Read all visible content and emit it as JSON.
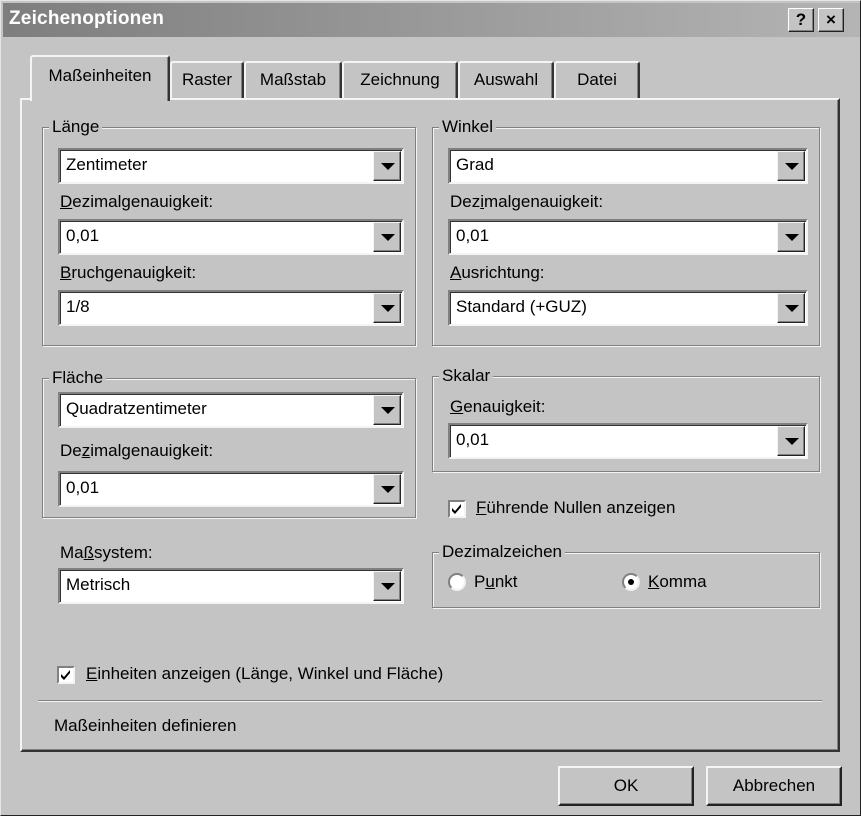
{
  "window": {
    "title": "Zeichenoptionen",
    "help_button": "?",
    "close_button": "×"
  },
  "tabs": [
    {
      "label": "Maßeinheiten",
      "active": true
    },
    {
      "label": "Raster"
    },
    {
      "label": "Maßstab"
    },
    {
      "label": "Zeichnung"
    },
    {
      "label": "Auswahl"
    },
    {
      "label": "Datei"
    }
  ],
  "laenge": {
    "group_label": "Länge",
    "unit_value": "Zentimeter",
    "decimal_label_u": "D",
    "decimal_label_rest": "ezimalgenauigkeit:",
    "decimal_value": "0,01",
    "fraction_label_u": "B",
    "fraction_label_rest": "ruchgenauigkeit:",
    "fraction_value": "1/8"
  },
  "winkel": {
    "group_label": "Winkel",
    "unit_value": "Grad",
    "decimal_label_pre": "Dez",
    "decimal_label_u": "i",
    "decimal_label_rest": "malgenauigkeit:",
    "decimal_value": "0,01",
    "orientation_label_u": "A",
    "orientation_label_rest": "usrichtung:",
    "orientation_value": "Standard (+GUZ)"
  },
  "flaeche": {
    "group_label": "Fläche",
    "unit_value": "Quadratzentimeter",
    "decimal_label_pre": "De",
    "decimal_label_u": "z",
    "decimal_label_rest": "imalgenauigkeit:",
    "decimal_value": "0,01"
  },
  "skalar": {
    "group_label": "Skalar",
    "precision_label_u": "G",
    "precision_label_rest": "enauigkeit:",
    "precision_value": "0,01"
  },
  "leading_zeros": {
    "checked": true,
    "label_u": "F",
    "label_rest": "ührende Nullen anzeigen"
  },
  "measure_system": {
    "label_pre": "Ma",
    "label_u": "ß",
    "label_rest": "system:",
    "value": "Metrisch"
  },
  "decimal_separator": {
    "group_label": "Dezimalzeichen",
    "option_point_pre": "P",
    "option_point_u": "u",
    "option_point_rest": "nkt",
    "option_comma_u": "K",
    "option_comma_rest": "omma",
    "selected": "Komma"
  },
  "show_units": {
    "checked": true,
    "label_u": "E",
    "label_rest": "inheiten anzeigen (Länge, Winkel und Fläche)"
  },
  "status_text": "Maßeinheiten definieren",
  "buttons": {
    "ok": "OK",
    "cancel": "Abbrechen"
  }
}
